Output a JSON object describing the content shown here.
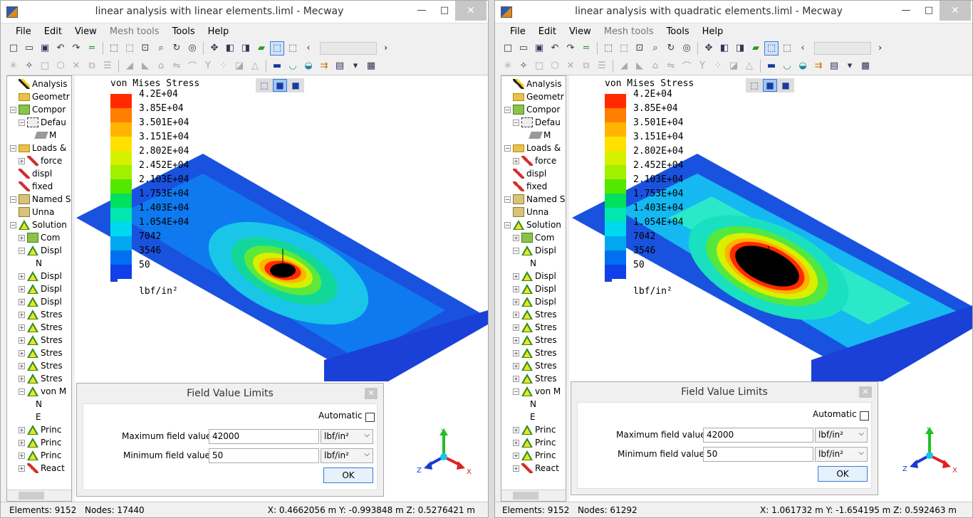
{
  "windows": [
    {
      "title": "linear analysis with linear elements.liml - Mecway",
      "menu": [
        "File",
        "Edit",
        "View",
        "Mesh tools",
        "Tools",
        "Help"
      ],
      "tree": [
        {
          "label": "Analysis",
          "indent": 1,
          "icon": "pen",
          "exp": ""
        },
        {
          "label": "Geometr",
          "indent": 1,
          "icon": "folder",
          "exp": ""
        },
        {
          "label": "Compor",
          "indent": 0,
          "icon": "comp",
          "exp": "−"
        },
        {
          "label": "Defau",
          "indent": 1,
          "icon": "puzzle",
          "exp": "−"
        },
        {
          "label": "M",
          "indent": 3,
          "icon": "mesh",
          "exp": ""
        },
        {
          "label": "Loads &",
          "indent": 0,
          "icon": "folder",
          "exp": "−"
        },
        {
          "label": "force",
          "indent": 1,
          "icon": "load",
          "exp": "+"
        },
        {
          "label": "displ",
          "indent": 1,
          "icon": "load",
          "exp": ""
        },
        {
          "label": "fixed",
          "indent": 1,
          "icon": "load",
          "exp": ""
        },
        {
          "label": "Named S",
          "indent": 0,
          "icon": "cube",
          "exp": "−"
        },
        {
          "label": "Unna",
          "indent": 1,
          "icon": "cube",
          "exp": ""
        },
        {
          "label": "Solution",
          "indent": 0,
          "icon": "tri",
          "exp": "−"
        },
        {
          "label": "Com",
          "indent": 1,
          "icon": "comp",
          "exp": "+"
        },
        {
          "label": "Displ",
          "indent": 1,
          "icon": "tri",
          "exp": "−"
        },
        {
          "label": "N",
          "indent": 3,
          "icon": "",
          "exp": ""
        },
        {
          "label": "Displ",
          "indent": 1,
          "icon": "tri",
          "exp": "+"
        },
        {
          "label": "Displ",
          "indent": 1,
          "icon": "tri",
          "exp": "+"
        },
        {
          "label": "Displ",
          "indent": 1,
          "icon": "tri",
          "exp": "+"
        },
        {
          "label": "Stres",
          "indent": 1,
          "icon": "tri",
          "exp": "+"
        },
        {
          "label": "Stres",
          "indent": 1,
          "icon": "tri",
          "exp": "+"
        },
        {
          "label": "Stres",
          "indent": 1,
          "icon": "tri",
          "exp": "+"
        },
        {
          "label": "Stres",
          "indent": 1,
          "icon": "tri",
          "exp": "+"
        },
        {
          "label": "Stres",
          "indent": 1,
          "icon": "tri",
          "exp": "+"
        },
        {
          "label": "Stres",
          "indent": 1,
          "icon": "tri",
          "exp": "+"
        },
        {
          "label": "von M",
          "indent": 1,
          "icon": "tri",
          "exp": "−"
        },
        {
          "label": "N",
          "indent": 3,
          "icon": "",
          "exp": ""
        },
        {
          "label": "E",
          "indent": 3,
          "icon": "",
          "exp": ""
        },
        {
          "label": "Princ",
          "indent": 1,
          "icon": "tri",
          "exp": "+"
        },
        {
          "label": "Princ",
          "indent": 1,
          "icon": "tri",
          "exp": "+"
        },
        {
          "label": "Princ",
          "indent": 1,
          "icon": "tri",
          "exp": "+"
        },
        {
          "label": "React",
          "indent": 1,
          "icon": "load",
          "exp": "+"
        }
      ],
      "legend": {
        "title": "von Mises Stress",
        "labels": [
          "4.2E+04",
          "3.85E+04",
          "3.501E+04",
          "3.151E+04",
          "2.802E+04",
          "2.452E+04",
          "2.103E+04",
          "1.753E+04",
          "1.403E+04",
          "1.054E+04",
          "7042",
          "3546",
          "50"
        ],
        "units": "lbf/in²"
      },
      "dialog": {
        "title": "Field Value Limits",
        "automatic_label": "Automatic",
        "max_label": "Maximum field value",
        "max_value": "42000",
        "min_label": "Minimum field value",
        "min_value": "50",
        "unit": "lbf/in²",
        "ok": "OK"
      },
      "axes": {
        "x": "X",
        "y": "Y",
        "z": "Z"
      },
      "status": {
        "elements": "Elements:  9152",
        "nodes": "Nodes: 17440",
        "coords": "X: 0.4662056 m Y: -0.993848 m Z: 0.5276421 m"
      }
    },
    {
      "title": "linear analysis with quadratic elements.liml - Mecway",
      "menu": [
        "File",
        "Edit",
        "View",
        "Mesh tools",
        "Tools",
        "Help"
      ],
      "tree": [
        {
          "label": "Analysis",
          "indent": 1,
          "icon": "pen",
          "exp": ""
        },
        {
          "label": "Geometr",
          "indent": 1,
          "icon": "folder",
          "exp": ""
        },
        {
          "label": "Compor",
          "indent": 0,
          "icon": "comp",
          "exp": "−"
        },
        {
          "label": "Defau",
          "indent": 1,
          "icon": "puzzle",
          "exp": "−"
        },
        {
          "label": "M",
          "indent": 3,
          "icon": "mesh",
          "exp": ""
        },
        {
          "label": "Loads &",
          "indent": 0,
          "icon": "folder",
          "exp": "−"
        },
        {
          "label": "force",
          "indent": 1,
          "icon": "load",
          "exp": "+"
        },
        {
          "label": "displ",
          "indent": 1,
          "icon": "load",
          "exp": ""
        },
        {
          "label": "fixed",
          "indent": 1,
          "icon": "load",
          "exp": ""
        },
        {
          "label": "Named S",
          "indent": 0,
          "icon": "cube",
          "exp": "−"
        },
        {
          "label": "Unna",
          "indent": 1,
          "icon": "cube",
          "exp": ""
        },
        {
          "label": "Solution",
          "indent": 0,
          "icon": "tri",
          "exp": "−"
        },
        {
          "label": "Com",
          "indent": 1,
          "icon": "comp",
          "exp": "+"
        },
        {
          "label": "Displ",
          "indent": 1,
          "icon": "tri",
          "exp": "−"
        },
        {
          "label": "N",
          "indent": 3,
          "icon": "",
          "exp": ""
        },
        {
          "label": "Displ",
          "indent": 1,
          "icon": "tri",
          "exp": "+"
        },
        {
          "label": "Displ",
          "indent": 1,
          "icon": "tri",
          "exp": "+"
        },
        {
          "label": "Displ",
          "indent": 1,
          "icon": "tri",
          "exp": "+"
        },
        {
          "label": "Stres",
          "indent": 1,
          "icon": "tri",
          "exp": "+"
        },
        {
          "label": "Stres",
          "indent": 1,
          "icon": "tri",
          "exp": "+"
        },
        {
          "label": "Stres",
          "indent": 1,
          "icon": "tri",
          "exp": "+"
        },
        {
          "label": "Stres",
          "indent": 1,
          "icon": "tri",
          "exp": "+"
        },
        {
          "label": "Stres",
          "indent": 1,
          "icon": "tri",
          "exp": "+"
        },
        {
          "label": "Stres",
          "indent": 1,
          "icon": "tri",
          "exp": "+"
        },
        {
          "label": "von M",
          "indent": 1,
          "icon": "tri",
          "exp": "−"
        },
        {
          "label": "N",
          "indent": 3,
          "icon": "",
          "exp": ""
        },
        {
          "label": "E",
          "indent": 3,
          "icon": "",
          "exp": ""
        },
        {
          "label": "Princ",
          "indent": 1,
          "icon": "tri",
          "exp": "+"
        },
        {
          "label": "Princ",
          "indent": 1,
          "icon": "tri",
          "exp": "+"
        },
        {
          "label": "Princ",
          "indent": 1,
          "icon": "tri",
          "exp": "+"
        },
        {
          "label": "React",
          "indent": 1,
          "icon": "load",
          "exp": "+"
        }
      ],
      "legend": {
        "title": "von Mises Stress",
        "labels": [
          "4.2E+04",
          "3.85E+04",
          "3.501E+04",
          "3.151E+04",
          "2.802E+04",
          "2.452E+04",
          "2.103E+04",
          "1.753E+04",
          "1.403E+04",
          "1.054E+04",
          "7042",
          "3546",
          "50"
        ],
        "units": "lbf/in²"
      },
      "dialog": {
        "title": "Field Value Limits",
        "automatic_label": "Automatic",
        "max_label": "Maximum field value",
        "max_value": "42000",
        "min_label": "Minimum field value",
        "min_value": "50",
        "unit": "lbf/in²",
        "ok": "OK"
      },
      "axes": {
        "x": "X",
        "y": "Y",
        "z": "Z"
      },
      "status": {
        "elements": "Elements:  9152",
        "nodes": "Nodes: 61292",
        "coords": "X: 1.061732 m Y: -1.654195 m Z: 0.592463 m"
      }
    }
  ],
  "legend_colors": [
    "#ff2a00",
    "#ff7d00",
    "#ffb400",
    "#ffe000",
    "#d6f000",
    "#a0f000",
    "#52e800",
    "#00e060",
    "#00e8b0",
    "#00d8f0",
    "#00a8f0",
    "#0070f0",
    "#1040e8"
  ],
  "colors": {
    "accent": "#3a7bd5",
    "selection": "#cfe3fb"
  }
}
